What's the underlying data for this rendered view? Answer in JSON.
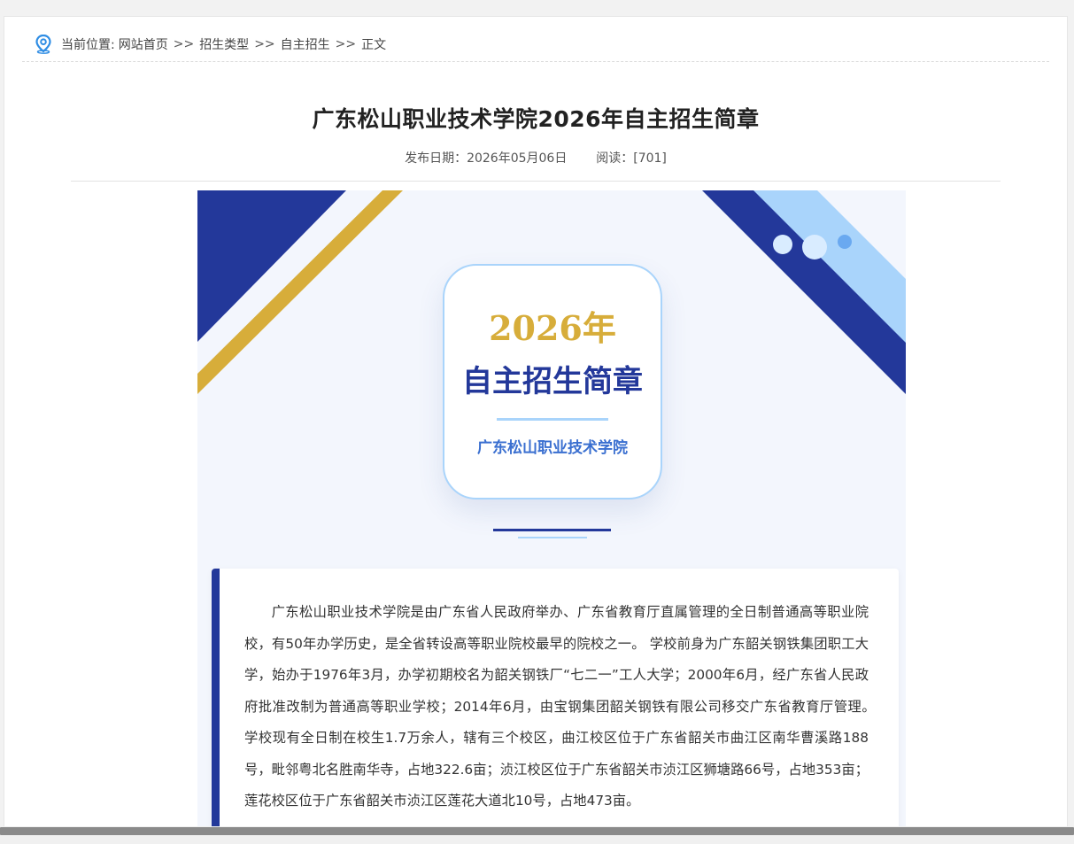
{
  "breadcrumb": {
    "prefix": "当前位置:",
    "items": [
      "网站首页",
      "招生类型",
      "自主招生",
      "正文"
    ],
    "separator": ">>"
  },
  "article": {
    "title": "广东松山职业技术学院2026年自主招生简章",
    "publish_date": "发布日期：2026年05月06日",
    "read_count": "阅读：[701]"
  },
  "poster": {
    "year": "2026年",
    "heading": "自主招生简章",
    "school": "广东松山职业技术学院",
    "colors": {
      "navy": "#23389a",
      "gold": "#d7ad3a",
      "sky": "#a9d4fb",
      "background": "#f3f6fd"
    }
  },
  "body": {
    "paragraph": "广东松山职业技术学院是由广东省人民政府举办、广东省教育厅直属管理的全日制普通高等职业院校，有50年办学历史，是全省转设高等职业院校最早的院校之一。 学校前身为广东韶关钢铁集团职工大学，始办于1976年3月，办学初期校名为韶关钢铁厂“七二一”工人大学；2000年6月，经广东省人民政府批准改制为普通高等职业学校；2014年6月，由宝钢集团韶关钢铁有限公司移交广东省教育厅管理。　　　学校现有全日制在校生1.7万余人，辖有三个校区，曲江校区位于广东省韶关市曲江区南华曹溪路188号，毗邻粤北名胜南华寺，占地322.6亩；浈江校区位于广东省韶关市浈江区狮塘路66号，占地353亩；莲花校区位于广东省韶关市浈江区莲花大道北10号，占地473亩。"
  }
}
